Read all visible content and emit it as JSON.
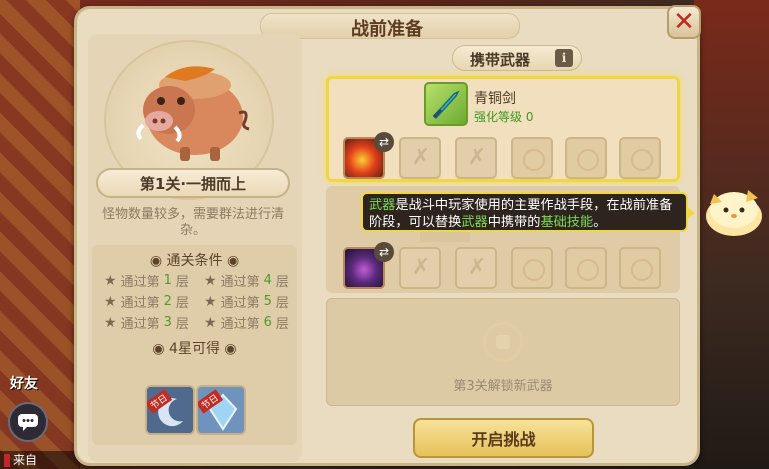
{
  "panel": {
    "title": "战前准备",
    "close_glyph": "✕"
  },
  "stage": {
    "name": "第1关·一拥而上",
    "description": "怪物数量较多，需要群法进行清杂。",
    "conditions_title": "通关条件",
    "conditions": [
      {
        "prefix": "通过第",
        "num": "1",
        "suffix": "层"
      },
      {
        "prefix": "通过第",
        "num": "4",
        "suffix": "层"
      },
      {
        "prefix": "通过第",
        "num": "2",
        "suffix": "层"
      },
      {
        "prefix": "通过第",
        "num": "5",
        "suffix": "层"
      },
      {
        "prefix": "通过第",
        "num": "3",
        "suffix": "层"
      },
      {
        "prefix": "通过第",
        "num": "6",
        "suffix": "层"
      }
    ],
    "reward_line": "4星可得",
    "reward_badges": [
      "节日",
      "节日"
    ]
  },
  "weapons": {
    "title": "携带武器",
    "info_glyph": "i",
    "weapon_name": "青铜剑",
    "weapon_level_label": "强化等级",
    "weapon_level_value": "0",
    "unlock_text": "第3关解锁新武器",
    "swap_glyph": "⇄",
    "empty_glyph": "✗"
  },
  "tooltip": {
    "part1": "武器",
    "part2": "是战斗中玩家使用的主要作战手段，在战前准备阶段，可以替换",
    "part3": "武器",
    "part4": "中携带的",
    "part5": "基础技能",
    "part6": "。"
  },
  "start_button": "开启挑战",
  "hud": {
    "friends_label": "好友",
    "chat_tag": "",
    "chat_text": "来自"
  },
  "colors": {
    "accent_yellow": "#f0d640",
    "green_text": "#3a9a1e",
    "panel_bg": "#e9dcc0",
    "close_red": "#c12a1d"
  }
}
